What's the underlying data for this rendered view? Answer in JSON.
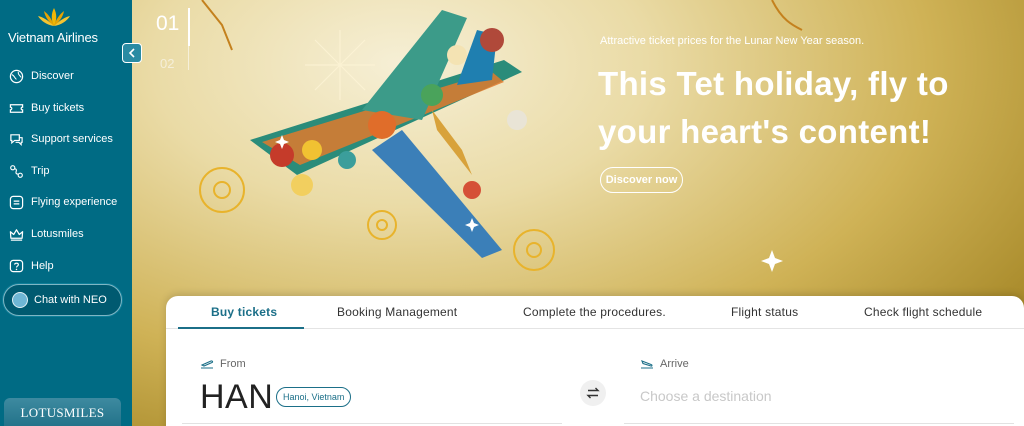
{
  "sidebar": {
    "brand": "Vietnam Airlines",
    "collapse_icon": "chevron-left-icon",
    "items": [
      {
        "label": "Discover",
        "icon": "globe-icon"
      },
      {
        "label": "Buy tickets",
        "icon": "ticket-icon"
      },
      {
        "label": "Support services",
        "icon": "chat-bubbles-icon"
      },
      {
        "label": "Trip",
        "icon": "route-icon"
      },
      {
        "label": "Flying experience",
        "icon": "list-icon"
      },
      {
        "label": "Lotusmiles",
        "icon": "crown-icon"
      },
      {
        "label": "Help",
        "icon": "question-icon"
      }
    ],
    "chat_label": "Chat with NEO",
    "lotus_card": "LOTUSMILES"
  },
  "hero": {
    "slide_current": "01",
    "slide_next": "02",
    "subtitle": "Attractive ticket prices for the Lunar New Year season.",
    "title": "This Tet holiday, fly to your heart's content!",
    "cta": "Discover now"
  },
  "booking": {
    "tabs": [
      "Buy tickets",
      "Booking Management",
      "Complete the procedures.",
      "Flight status",
      "Check flight schedule"
    ],
    "active_tab": "Buy tickets",
    "from_label": "From",
    "from_code": "HAN",
    "from_city": "Hanoi, Vietnam",
    "arrive_label": "Arrive",
    "destination_placeholder": "Choose a destination"
  },
  "colors": {
    "sidebar_bg": "#006b84",
    "accent": "#1b6f88",
    "hero_gold": "#cfb256"
  }
}
